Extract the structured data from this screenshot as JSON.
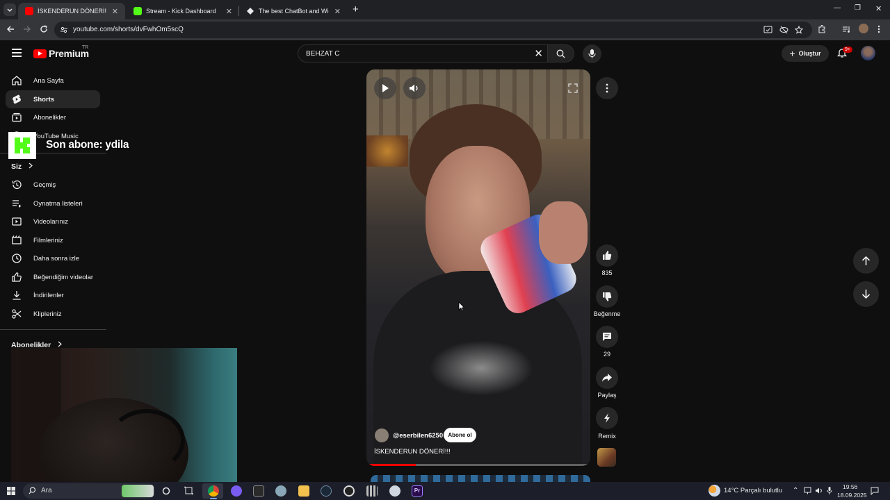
{
  "browser": {
    "tabs": [
      {
        "label": "İSKENDERUN DÖNERİ!!! - YouTube",
        "close": "✕",
        "color": "#ff0000"
      },
      {
        "label": "Stream - Kick Dashboard",
        "close": "✕",
        "color": "#53fc18"
      },
      {
        "label": "The best ChatBot and Widgets",
        "close": "✕",
        "color": "#e8eaed"
      }
    ],
    "new_tab": "+",
    "window_controls": {
      "minimize": "—",
      "restore": "❐",
      "close": "✕"
    },
    "url": "youtube.com/shorts/dvFwhOm5scQ"
  },
  "youtube": {
    "brand": "Premium",
    "country": "TR",
    "search": {
      "value": "BEHZAT C",
      "clear": "✕"
    },
    "create_label": "Oluştur",
    "notification_count": "9+",
    "sidebar": {
      "items": [
        {
          "label": "Ana Sayfa",
          "icon": "home-icon"
        },
        {
          "label": "Shorts",
          "icon": "shorts-icon"
        },
        {
          "label": "Abonelikler",
          "icon": "subscriptions-icon"
        },
        {
          "label": "YouTube Music",
          "icon": "youtube-music-icon"
        }
      ],
      "you_header": "Siz",
      "you_items": [
        {
          "label": "Geçmiş",
          "icon": "history-icon"
        },
        {
          "label": "Oynatma listeleri",
          "icon": "playlists-icon"
        },
        {
          "label": "Videolarınız",
          "icon": "your-videos-icon"
        },
        {
          "label": "Filmleriniz",
          "icon": "movies-icon"
        },
        {
          "label": "Daha sonra izle",
          "icon": "watch-later-icon"
        },
        {
          "label": "Beğendiğim videolar",
          "icon": "liked-videos-icon"
        },
        {
          "label": "İndirilenler",
          "icon": "downloads-icon"
        },
        {
          "label": "Klipleriniz",
          "icon": "clips-icon"
        }
      ],
      "subs_header": "Abonelikler"
    },
    "short": {
      "channel": "@eserbilen6250",
      "subscribe_label": "Abone ol",
      "title": "İSKENDERUN DÖNERİ!!!",
      "progress": 0.22,
      "actions": {
        "like_count": "835",
        "dislike_label": "Beğenme",
        "comment_count": "29",
        "share_label": "Paylaş",
        "remix_label": "Remix"
      }
    }
  },
  "overlay": {
    "kick_alert": "Son abone: ydila"
  },
  "taskbar": {
    "search_label": "Ara",
    "weather": "14°C  Parçalı bulutlu",
    "time": "19:56",
    "date": "18.09.2025"
  },
  "colors": {
    "youtube_red": "#ff0000",
    "kick_green": "#53fc18",
    "bg": "#0f0f0f"
  }
}
